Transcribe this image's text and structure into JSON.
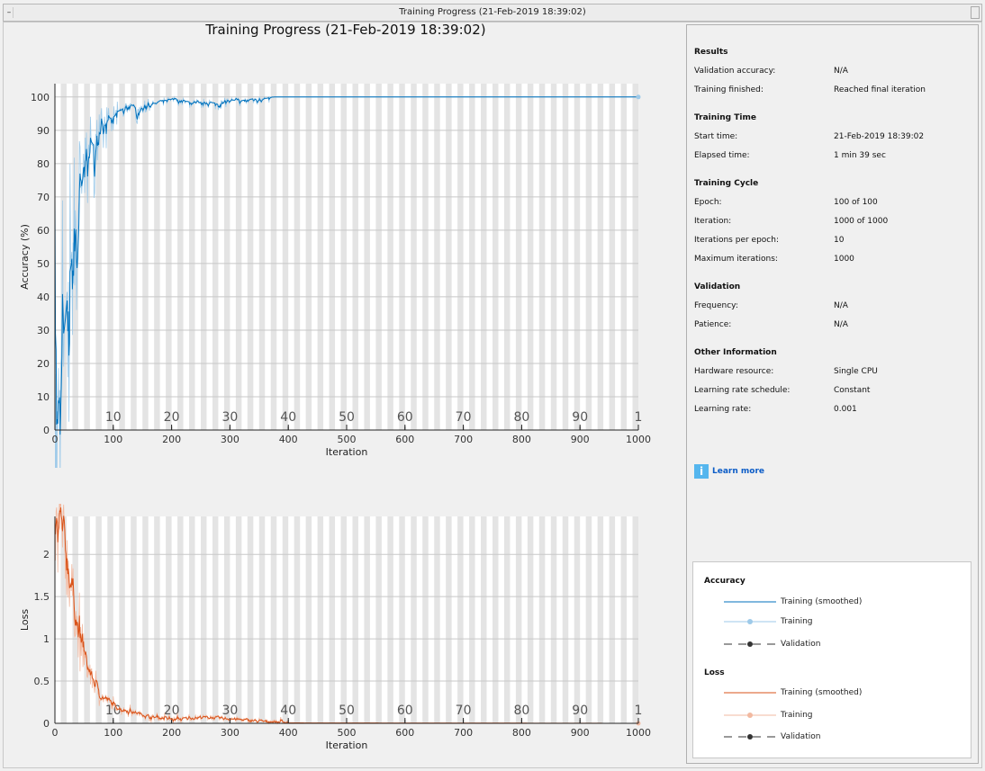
{
  "window": {
    "title": "Training Progress (21-Feb-2019 18:39:02)"
  },
  "main_title": "Training Progress (21-Feb-2019 18:39:02)",
  "results": {
    "sections": [
      {
        "title": "Results",
        "rows": [
          [
            "Validation accuracy:",
            "N/A"
          ],
          [
            "Training finished:",
            "Reached final iteration"
          ]
        ]
      },
      {
        "title": "Training Time",
        "rows": [
          [
            "Start time:",
            "21-Feb-2019 18:39:02"
          ],
          [
            "Elapsed time:",
            "1 min 39 sec"
          ]
        ]
      },
      {
        "title": "Training Cycle",
        "rows": [
          [
            "Epoch:",
            "100 of 100"
          ],
          [
            "Iteration:",
            "1000 of 1000"
          ],
          [
            "Iterations per epoch:",
            "10"
          ],
          [
            "Maximum iterations:",
            "1000"
          ]
        ]
      },
      {
        "title": "Validation",
        "rows": [
          [
            "Frequency:",
            "N/A"
          ],
          [
            "Patience:",
            "N/A"
          ]
        ]
      },
      {
        "title": "Other Information",
        "rows": [
          [
            "Hardware resource:",
            "Single CPU"
          ],
          [
            "Learning rate schedule:",
            "Constant"
          ],
          [
            "Learning rate:",
            "0.001"
          ]
        ]
      }
    ],
    "learn_more": "Learn more"
  },
  "legend": {
    "accuracy_title": "Accuracy",
    "loss_title": "Loss",
    "training_smoothed": "Training (smoothed)",
    "training": "Training",
    "validation": "Validation"
  },
  "colors": {
    "acc_smooth": "#0072bd",
    "acc_raw": "#9ecae9",
    "loss_smooth": "#d95319",
    "loss_raw": "#f2b9a0",
    "stripe": "#e4e4e4"
  },
  "chart_data": [
    {
      "type": "line",
      "title": "",
      "xlabel": "Iteration",
      "ylabel": "Accuracy (%)",
      "xlim": [
        0,
        1000
      ],
      "ylim": [
        0,
        104
      ],
      "xticks": [
        0,
        100,
        200,
        300,
        400,
        500,
        600,
        700,
        800,
        900,
        1000
      ],
      "yticks": [
        0,
        10,
        20,
        30,
        40,
        50,
        60,
        70,
        80,
        90,
        100
      ],
      "epoch_labels": [
        "10",
        "20",
        "30",
        "40",
        "50",
        "60",
        "70",
        "80",
        "90",
        "1"
      ],
      "epoch_label_iters": [
        100,
        200,
        300,
        400,
        500,
        600,
        700,
        800,
        900,
        1000
      ],
      "iterations_per_epoch": 10,
      "grid": true,
      "series": [
        {
          "name": "Training (smoothed)",
          "x": [
            0,
            5,
            10,
            20,
            30,
            40,
            50,
            60,
            70,
            80,
            90,
            100,
            110,
            120,
            130,
            140,
            150,
            160,
            170,
            180,
            190,
            200,
            220,
            240,
            260,
            280,
            300,
            320,
            340,
            360,
            370,
            1000
          ],
          "y": [
            28,
            0,
            20,
            40,
            55,
            68,
            80,
            86,
            85,
            90,
            93,
            94,
            96,
            97,
            98,
            96,
            97,
            98,
            98,
            99,
            99,
            99.5,
            99,
            98,
            98.5,
            98,
            99,
            99,
            99.5,
            99.5,
            100,
            100
          ]
        }
      ]
    },
    {
      "type": "line",
      "title": "",
      "xlabel": "Iteration",
      "ylabel": "Loss",
      "xlim": [
        0,
        1000
      ],
      "ylim": [
        0,
        2.45
      ],
      "xticks": [
        0,
        100,
        200,
        300,
        400,
        500,
        600,
        700,
        800,
        900,
        1000
      ],
      "yticks": [
        0,
        0.5,
        1,
        1.5,
        2
      ],
      "ytick_labels": [
        "0",
        "0.5",
        "1",
        "1.5",
        "2"
      ],
      "epoch_labels": [
        "10",
        "20",
        "30",
        "40",
        "50",
        "60",
        "70",
        "80",
        "90",
        "1"
      ],
      "epoch_label_iters": [
        100,
        200,
        300,
        400,
        500,
        600,
        700,
        800,
        900,
        1000
      ],
      "iterations_per_epoch": 10,
      "grid": true,
      "series": [
        {
          "name": "Training (smoothed)",
          "x": [
            0,
            10,
            20,
            30,
            40,
            50,
            60,
            70,
            80,
            90,
            100,
            120,
            140,
            160,
            180,
            200,
            250,
            300,
            350,
            400,
            1000
          ],
          "y": [
            2.15,
            2.2,
            1.9,
            1.5,
            1.0,
            0.75,
            0.55,
            0.42,
            0.3,
            0.27,
            0.2,
            0.15,
            0.12,
            0.08,
            0.06,
            0.04,
            0.07,
            0.05,
            0.02,
            0.005,
            0
          ]
        }
      ]
    }
  ]
}
